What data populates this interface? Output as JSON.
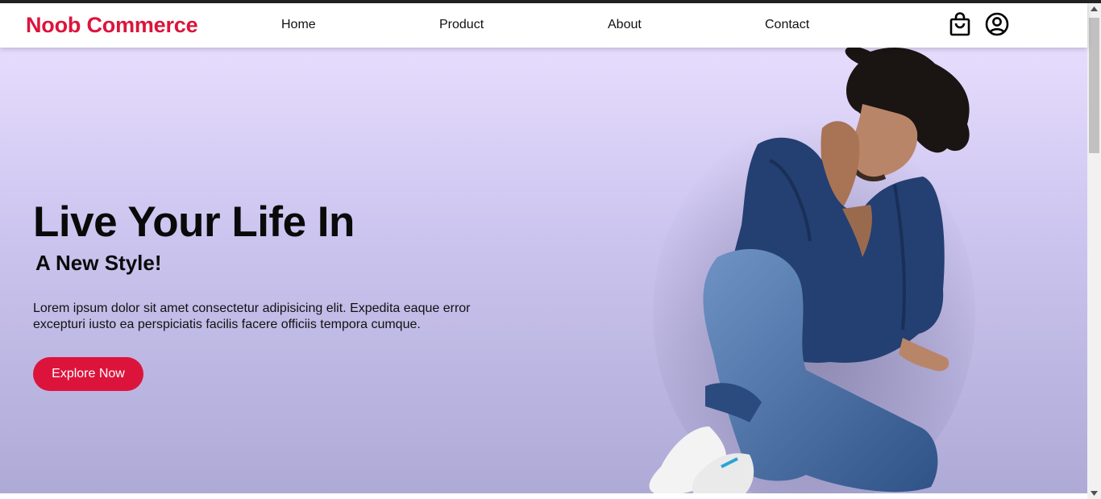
{
  "brand": "Noob Commerce",
  "nav": {
    "home": "Home",
    "product": "Product",
    "about": "About",
    "contact": "Contact"
  },
  "icons": {
    "cart": "shopping-bag-icon",
    "account": "user-circle-icon"
  },
  "hero": {
    "title": "Live Your Life In",
    "subtitle": "A New Style!",
    "text": "Lorem ipsum dolor sit amet consectetur adipisicing elit. Expedita eaque error excepturi iusto ea perspiciatis facilis facere officiis tempora cumque.",
    "cta": "Explore Now"
  },
  "colors": {
    "accent": "#dc143c",
    "hero_top": "#e6dcfd",
    "hero_bottom": "#aeaad6"
  }
}
